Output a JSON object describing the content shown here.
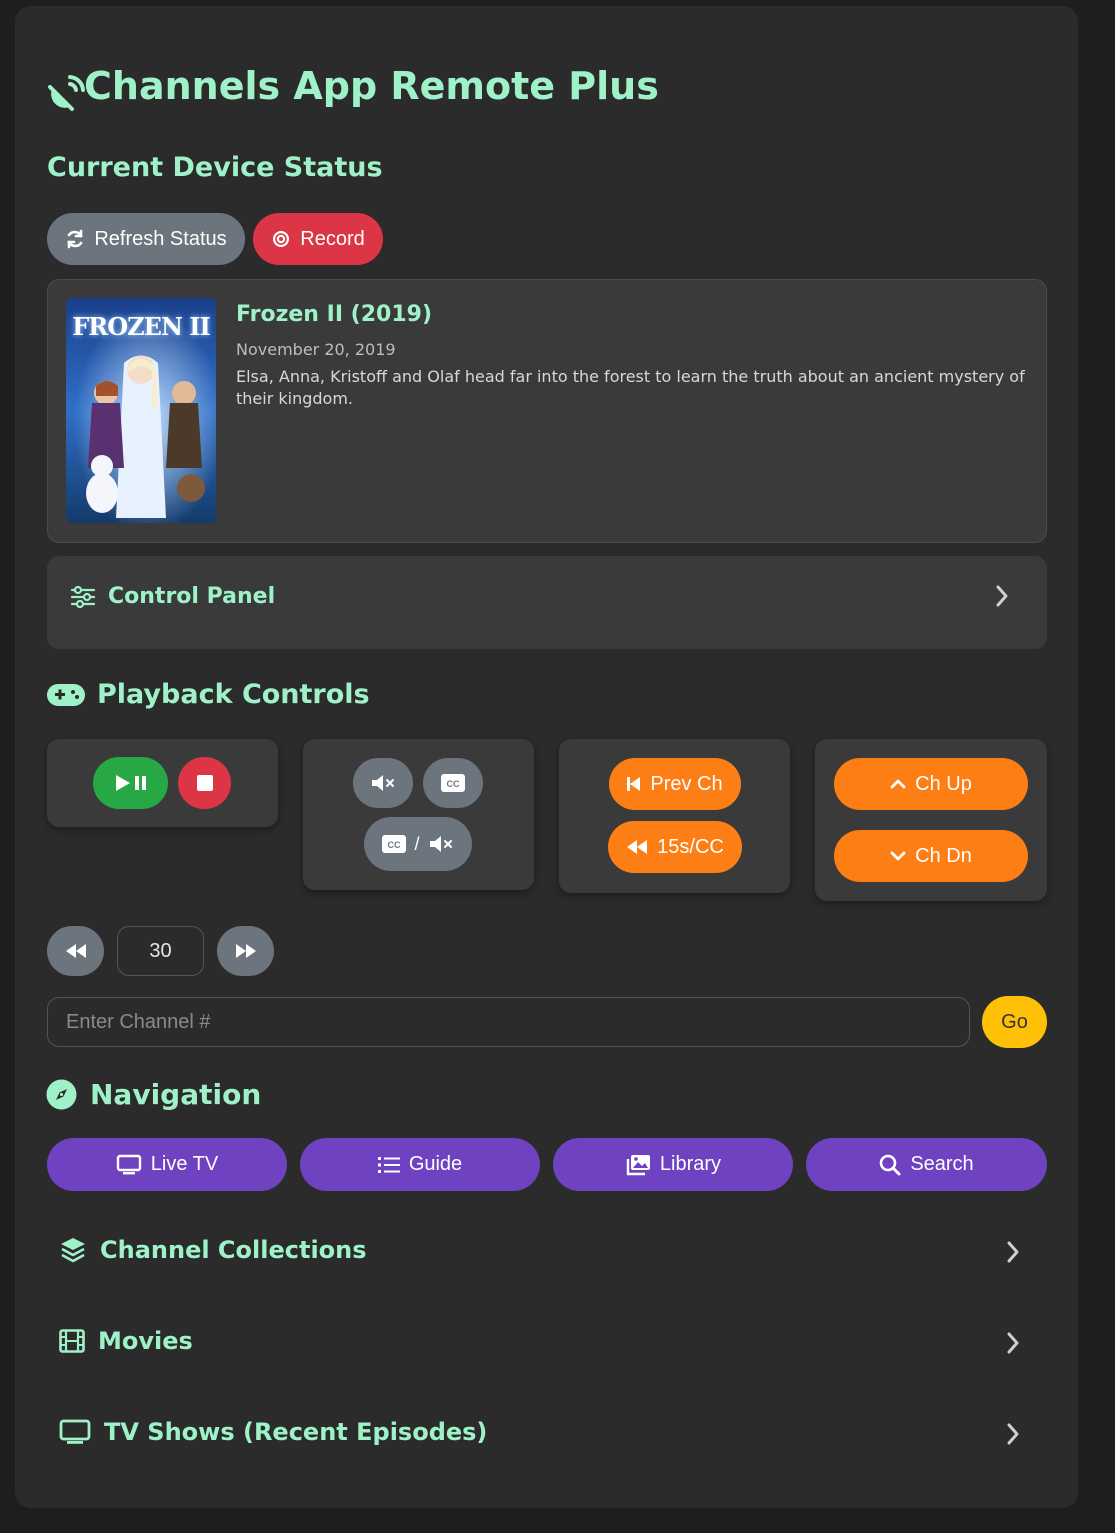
{
  "app": {
    "title": "Channels App Remote Plus"
  },
  "status": {
    "heading": "Current Device Status",
    "refresh_label": "Refresh Status",
    "record_label": "Record"
  },
  "now_playing": {
    "title": "Frozen II (2019)",
    "date": "November 20, 2019",
    "description": "Elsa, Anna, Kristoff and Olaf head far into the forest to learn the truth about an ancient mystery of their kingdom.",
    "poster_text": "FROZEN II"
  },
  "control_panel": {
    "label": "Control Panel"
  },
  "playback": {
    "heading": "Playback Controls",
    "prev_ch": "Prev Ch",
    "skip_cc": "15s/CC",
    "ch_up": "Ch Up",
    "ch_dn": "Ch Dn",
    "cc_mute_sep": "/",
    "seek_value": "30"
  },
  "channel_entry": {
    "placeholder": "Enter Channel #",
    "go_label": "Go"
  },
  "navigation": {
    "heading": "Navigation",
    "buttons": [
      "Live TV",
      "Guide",
      "Library",
      "Search"
    ]
  },
  "sections": [
    {
      "label": "Channel Collections"
    },
    {
      "label": "Movies"
    },
    {
      "label": "TV Shows (Recent Episodes)"
    }
  ],
  "colors": {
    "accent": "#9ff2c8",
    "gray": "#6c757d",
    "red": "#dc3545",
    "green": "#28a745",
    "orange": "#fd7e14",
    "purple": "#6f42c1",
    "yellow": "#ffc107"
  },
  "icons": {
    "app": "satellite-dish-icon",
    "refresh": "sync-icon",
    "record": "record-icon",
    "control_panel": "sliders-icon",
    "playback": "gamepad-icon",
    "navigation": "compass-icon",
    "collections": "layers-icon",
    "movies": "film-icon",
    "tv_shows": "tv-icon"
  }
}
